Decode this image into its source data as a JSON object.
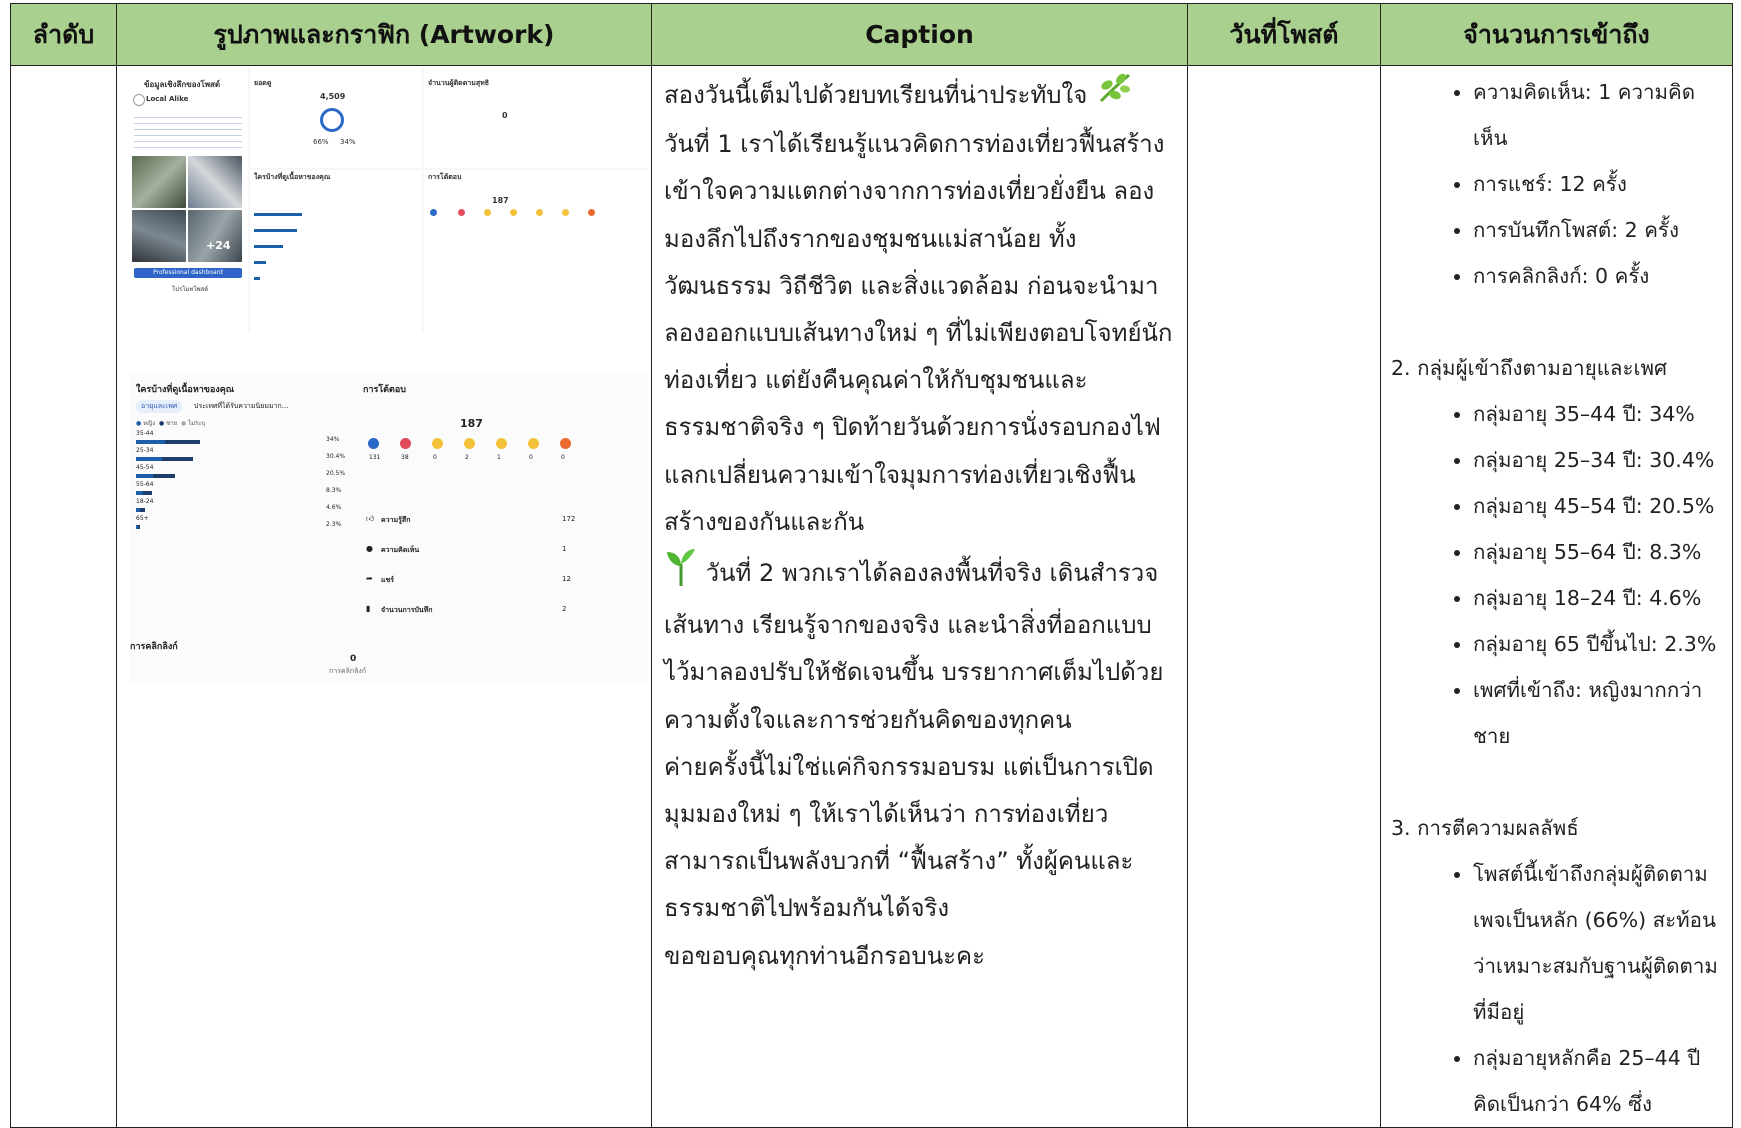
{
  "headers": {
    "order": "ลำดับ",
    "artwork": "รูปภาพและกราฟิก (Artwork)",
    "caption": "Caption",
    "post_date": "วันที่โพสต์",
    "reach": "จำนวนการเข้าถึง"
  },
  "caption": {
    "p1": "สองวันนี้เต็มไปด้วยบทเรียนที่น่าประทับใจ",
    "p2": "วันที่ 1 เราได้เรียนรู้แนวคิดการท่องเที่ยวฟื้นสร้าง เข้าใจความแตกต่างจากการท่องเที่ยวยั่งยืน ลองมองลึกไปถึงรากของชุมชนแม่สาน้อย ทั้งวัฒนธรรม วิถีชีวิต และสิ่งแวดล้อม ก่อนจะนำมาลองออกแบบเส้นทางใหม่ ๆ ที่ไม่เพียงตอบโจทย์นักท่องเที่ยว แต่ยังคืนคุณค่าให้กับชุมชนและธรรมชาติจริง ๆ ปิดท้ายวันด้วยการนั่งรอบกองไฟ แลกเปลี่ยนความเข้าใจมุมการท่องเที่ยวเชิงฟื้นสร้างของกันและกัน",
    "p3": "วันที่ 2 พวกเราได้ลองลงพื้นที่จริง เดินสำรวจเส้นทาง เรียนรู้จากของจริง และนำสิ่งที่ออกแบบไว้มาลองปรับให้ชัดเจนขึ้น บรรยากาศเต็มไปด้วยความตั้งใจและการช่วยกันคิดของทุกคน",
    "p4": "ค่ายครั้งนี้ไม่ใช่แค่กิจกรรมอบรม แต่เป็นการเปิดมุมมองใหม่ ๆ ให้เราได้เห็นว่า การท่องเที่ยวสามารถเป็นพลังบวกที่ “ฟื้นสร้าง” ทั้งผู้คนและธรรมชาติไปพร้อมกันได้จริง",
    "p5": "ขอขอบคุณทุกท่านอีกรอบนะคะ"
  },
  "reach": {
    "engagement": [
      "ความคิดเห็น: 1 ความคิดเห็น",
      "การแชร์: 12 ครั้ง",
      "การบันทึกโพสต์: 2 ครั้ง",
      "การคลิกลิงก์: 0 ครั้ง"
    ],
    "section2_title": "2. กลุ่มผู้เข้าถึงตามอายุและเพศ",
    "age_gender": [
      "กลุ่มอายุ 35–44 ปี: 34%",
      "กลุ่มอายุ 25–34 ปี: 30.4%",
      "กลุ่มอายุ 45–54 ปี: 20.5%",
      "กลุ่มอายุ 55–64 ปี: 8.3%",
      "กลุ่มอายุ 18–24 ปี: 4.6%",
      "กลุ่มอายุ 65 ปีขึ้นไป: 2.3%",
      "เพศที่เข้าถึง: หญิงมากกว่าชาย"
    ],
    "section3_title": "3. การตีความผลลัพธ์",
    "interpretation": [
      "โพสต์นี้เข้าถึงกลุ่มผู้ติดตามเพจเป็นหลัก (66%) สะท้อนว่าเหมาะสมกับฐานผู้ติดตามที่มีอยู่",
      "กลุ่มอายุหลักคือ 25–44 ปี คิดเป็นกว่า 64% ซึ่ง"
    ]
  },
  "screenshot1": {
    "title": "ข้อมูลเชิงลึกของโพสต์",
    "page_name": "Local Alike",
    "views_label": "ยอดดู",
    "views_value": "4,509",
    "followers_pct": "66%",
    "nonfollowers_pct": "34%",
    "new_followers_label": "จำนวนผู้ติดตามสุทธิ",
    "new_followers_value": "0",
    "audience_label": "ใครบ้างที่ดูเนื้อหาของคุณ",
    "interactions_label": "การโต้ตอบ",
    "interactions_total": "187",
    "photo_more": "+24",
    "dashboard_button": "Professional dashboard",
    "boost_button": "โปรโมทโพสต์"
  },
  "screenshot2": {
    "audience_label": "ใครบ้างที่ดูเนื้อหาของคุณ",
    "tab_age": "อายุและเพศ",
    "tab_country": "ประเทศที่ได้รับความนิยมมาก...",
    "legend": [
      "หญิง",
      "ชาย",
      "ไม่ระบุ"
    ],
    "age_rows": [
      {
        "label": "35-44",
        "pct": "34%",
        "value": 34
      },
      {
        "label": "25-34",
        "pct": "30.4%",
        "value": 30.4
      },
      {
        "label": "45-54",
        "pct": "20.5%",
        "value": 20.5
      },
      {
        "label": "55-64",
        "pct": "8.3%",
        "value": 8.3
      },
      {
        "label": "18-24",
        "pct": "4.6%",
        "value": 4.6
      },
      {
        "label": "65+",
        "pct": "2.3%",
        "value": 2.3
      }
    ],
    "interactions_label": "การโต้ตอบ",
    "interactions_total": "187",
    "reaction_counts": [
      "131",
      "38",
      "0",
      "2",
      "1",
      "0",
      "0"
    ],
    "metrics": [
      {
        "label": "ความรู้สึก",
        "value": "172"
      },
      {
        "label": "ความคิดเห็น",
        "value": "1"
      },
      {
        "label": "แชร์",
        "value": "12"
      },
      {
        "label": "จำนวนการบันทึก",
        "value": "2"
      }
    ],
    "link_clicks_label": "การคลิกลิงก์",
    "link_clicks_value": "0",
    "link_clicks_sub": "การคลิกลิงก์"
  },
  "colors": {
    "header_bg": "#a9d08e",
    "bar_blue": "#1b5fab",
    "bar_navy": "#1d3d6a"
  }
}
